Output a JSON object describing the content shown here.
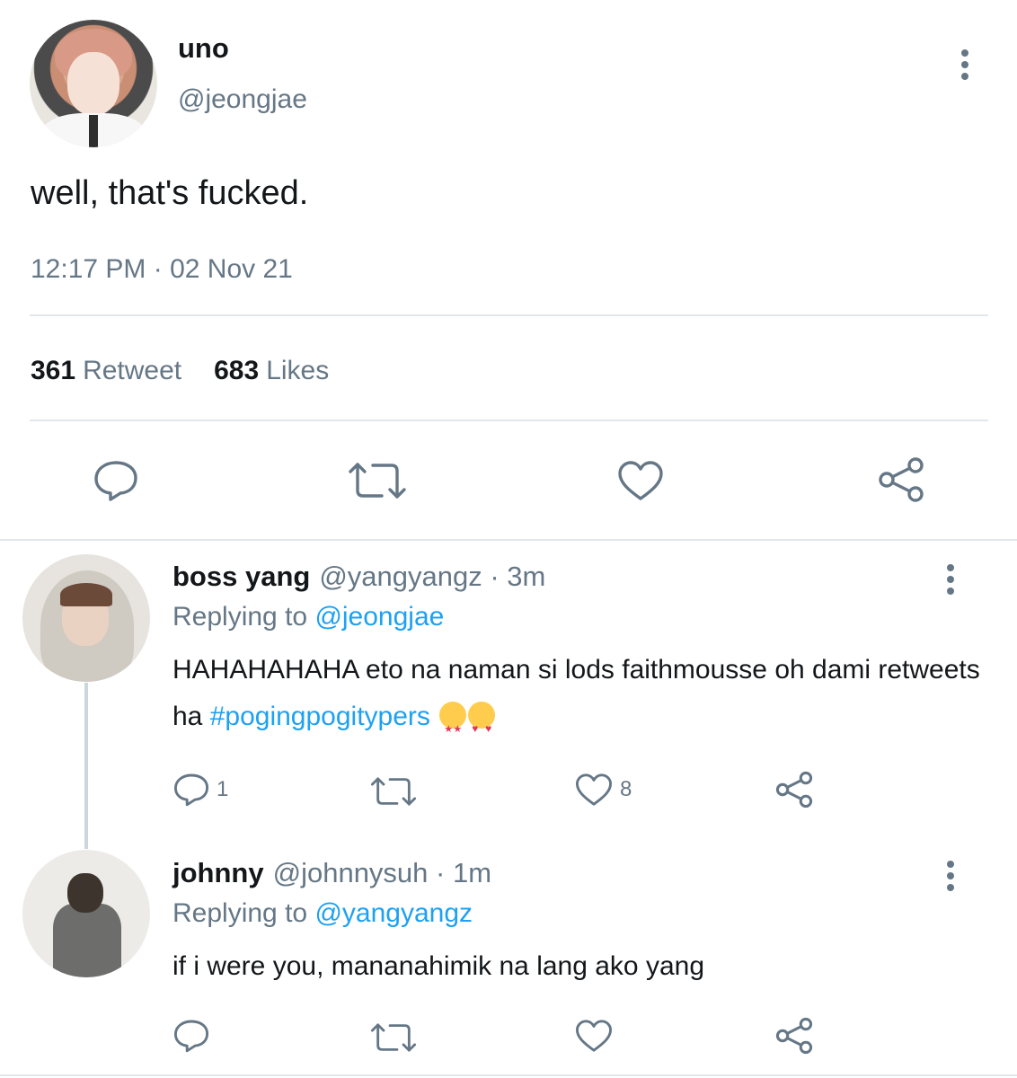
{
  "main_tweet": {
    "display_name": "uno",
    "handle": "@jeongjae",
    "text": "well, that's fucked.",
    "timestamp": "12:17 PM · 02 Nov 21",
    "stats": {
      "retweet_count": "361",
      "retweet_label": "Retweet",
      "likes_count": "683",
      "likes_label": "Likes"
    },
    "actions": [
      "reply-icon",
      "retweet-icon",
      "like-icon",
      "share-icon"
    ]
  },
  "replies": [
    {
      "display_name": "boss yang",
      "handle": "@yangyangz",
      "time": "· 3m",
      "replying_prefix": "Replying to",
      "replying_to": "@jeongjae",
      "text": "HAHAHAHAHA eto na naman si lods faithmousse oh dami retweets ha",
      "hashtag": "#pogingpogitypers",
      "emojis": [
        "star-struck-emoji",
        "heart-eyes-emoji"
      ],
      "reply_count": "1",
      "like_count": "8"
    },
    {
      "display_name": "johnny",
      "handle": "@johnnysuh",
      "time": "· 1m",
      "replying_prefix": "Replying to",
      "replying_to": "@yangyangz",
      "text": "if i were you, mananahimik na lang ako yang"
    }
  ],
  "colors": {
    "text": "#14171a",
    "secondary": "#657786",
    "link": "#1da1f2",
    "divider": "#e1e8ed"
  }
}
